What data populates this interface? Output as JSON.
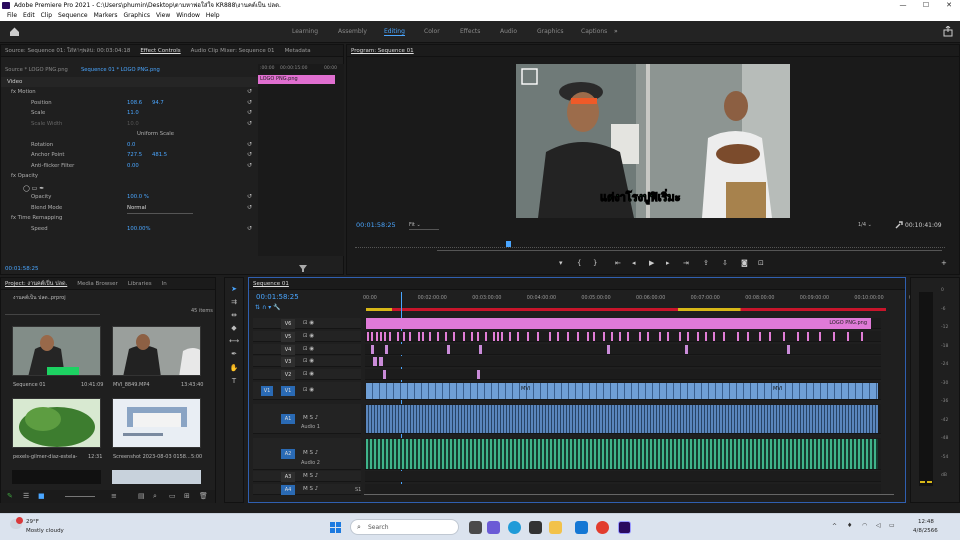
{
  "app": {
    "title": "Adobe Premiere Pro 2021 - C:\\Users\\phumin\\Desktop\\ตามหาพ่อใส่ใจ KR888\\งานคต์เป็น ปลด."
  },
  "window_controls": {
    "minimize": "—",
    "maximize": "☐",
    "close": "✕"
  },
  "menu": [
    "File",
    "Edit",
    "Clip",
    "Sequence",
    "Markers",
    "Graphics",
    "View",
    "Window",
    "Help"
  ],
  "workspaces": [
    "Learning",
    "Assembly",
    "Editing",
    "Color",
    "Effects",
    "Audio",
    "Graphics",
    "Captions"
  ],
  "workspace_more": "»",
  "source_tabs": [
    "Source: Sequence 01: ใส่หาๆพลบ: 00:03:04:18",
    "Effect Controls",
    "Audio Clip Mixer: Sequence 01",
    "Metadata"
  ],
  "effect_controls": {
    "source_label": "Source * LOGO PNG.png",
    "seq_label": "Sequence 01 * LOGO PNG.png",
    "clip_bar_label": "LOGO PNG.png",
    "ruler_times": [
      ":00:00",
      "00:00:15:00",
      "00:00"
    ],
    "video_header": "Video",
    "rows": [
      {
        "label": "fx  Motion",
        "v1": "",
        "v2": ""
      },
      {
        "label": "Position",
        "v1": "108.6",
        "v2": "94.7"
      },
      {
        "label": "Scale",
        "v1": "11.0",
        "v2": ""
      },
      {
        "label": "Scale Width",
        "v1": "10.0",
        "v2": ""
      },
      {
        "label": "Uniform Scale",
        "v1": "",
        "v2": ""
      },
      {
        "label": "Rotation",
        "v1": "0.0",
        "v2": ""
      },
      {
        "label": "Anchor Point",
        "v1": "727.5",
        "v2": "481.5"
      },
      {
        "label": "Anti-flicker Filter",
        "v1": "0.00",
        "v2": ""
      },
      {
        "label": "fx  Opacity",
        "v1": "",
        "v2": ""
      },
      {
        "label": "",
        "v1": "",
        "v2": ""
      },
      {
        "label": "Opacity",
        "v1": "100.0 %",
        "v2": ""
      },
      {
        "label": "Blend Mode",
        "v1": "Normal",
        "v2": ""
      },
      {
        "label": "fx  Time Remapping",
        "v1": "",
        "v2": ""
      },
      {
        "label": "Speed",
        "v1": "100.00%",
        "v2": ""
      }
    ],
    "timecode": "00:01:58:25"
  },
  "program": {
    "tab": "Program: Sequence 01",
    "timecode": "00:01:58:25",
    "fit": "Fit",
    "ratio": "1/4",
    "duration": "00:10:41:09",
    "caption": "แต่งาโรงปูฟิเริ่มะ"
  },
  "project": {
    "tabs": [
      "Project: งานคต์เป็น ปลด.",
      "Media Browser",
      "Libraries",
      "In"
    ],
    "file": "งานคต์เป็น ปลด..prproj",
    "count": "45 items",
    "items": [
      {
        "name": "Sequence 01",
        "dur": "10:41:09"
      },
      {
        "name": "MVI_8849.MP4",
        "dur": "13:43:40"
      },
      {
        "name": "pexels-gilmer-diaz-estela-",
        "dur": "12:31"
      },
      {
        "name": "Screenshot 2023-08-03 0158...",
        "dur": "5:00"
      }
    ]
  },
  "timeline": {
    "tab": "Sequence 01",
    "timecode": "00:01:58:25",
    "ruler": [
      "00:00",
      "00:02:00:00",
      "00:03:00:00",
      "00:04:00:00",
      "00:05:00:00",
      "00:06:00:00",
      "00:07:00:00",
      "00:08:00:00",
      "00:09:00:00",
      "00:10:00:00",
      "00:1"
    ],
    "tracks": [
      "V6",
      "V5",
      "V4",
      "V3",
      "V2",
      "V1",
      "A1",
      "A2",
      "A3",
      "A4"
    ],
    "audio_names": [
      "Audio 1",
      "Audio 2"
    ],
    "logo_clip": "LOGO PNG.png",
    "mvi_labels": [
      "MVI",
      "MVI"
    ],
    "master_label": "S1"
  },
  "meter": {
    "scale": [
      "0",
      "-6",
      "-12",
      "-18",
      "-24",
      "-30",
      "-36",
      "-42",
      "-48",
      "-54",
      "dB"
    ]
  },
  "taskbar": {
    "weather_temp": "29°F",
    "weather_desc": "Mostly cloudy",
    "search": "Search",
    "time": "12:48",
    "date": "4/8/2566"
  }
}
